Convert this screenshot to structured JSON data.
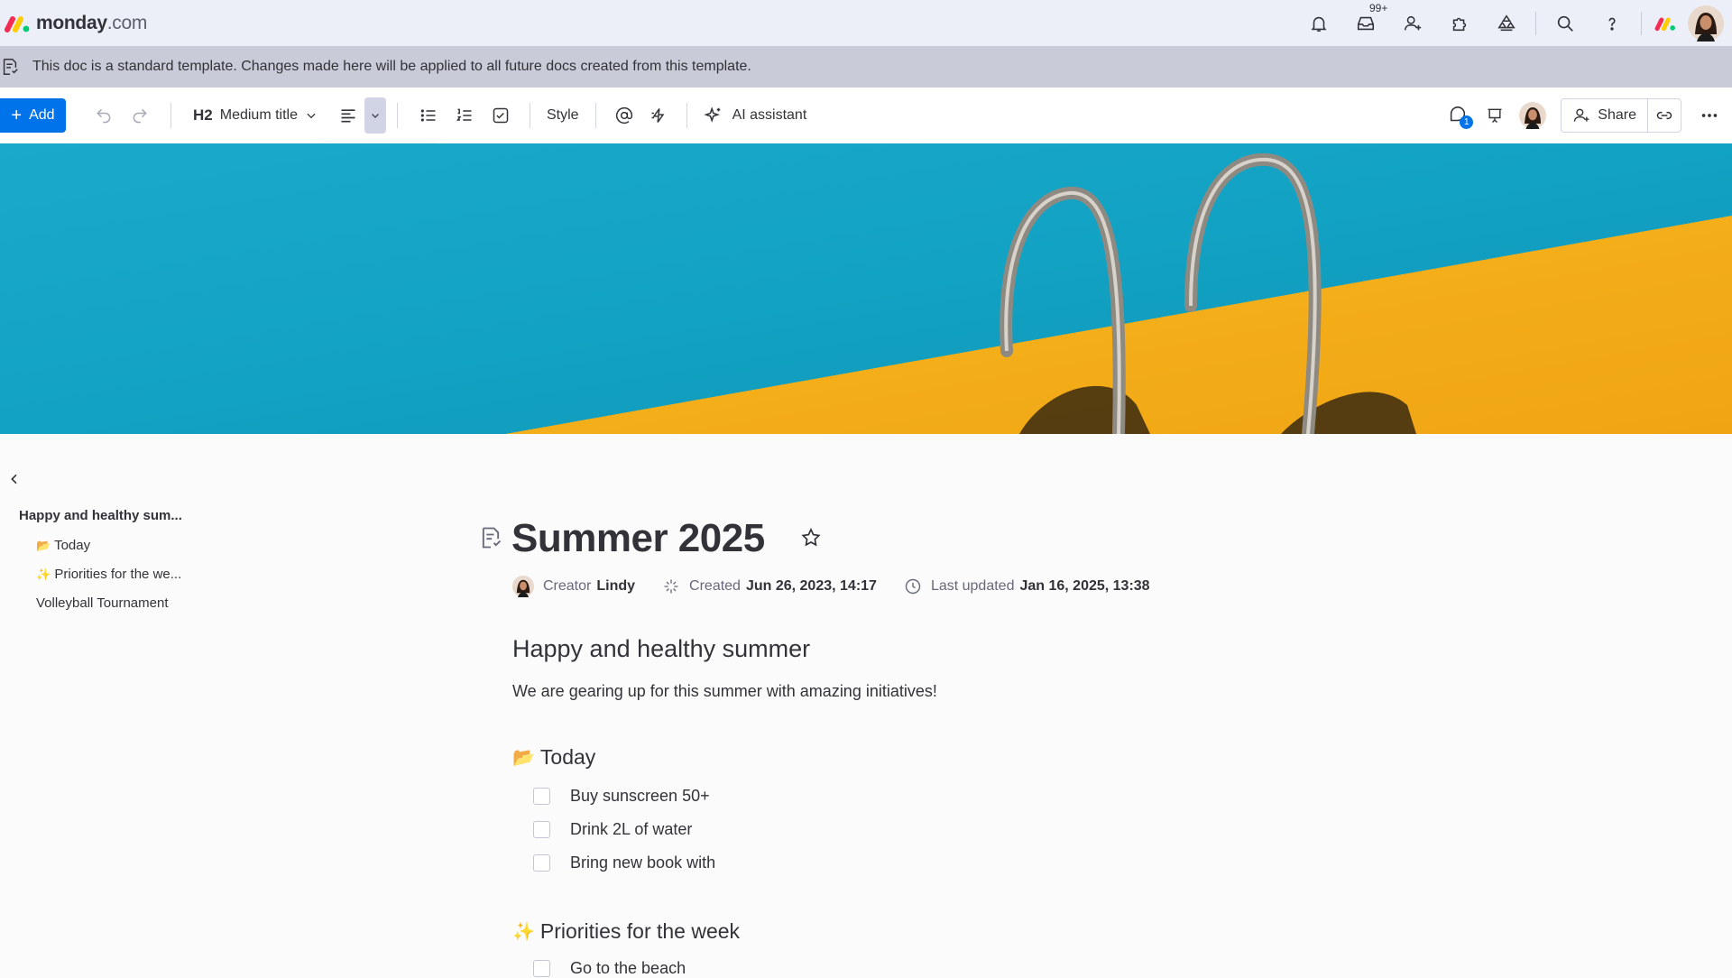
{
  "topbar": {
    "logo_text": "monday",
    "logo_suffix": ".com",
    "inbox_badge": "99+",
    "icons": [
      "bell-icon",
      "inbox-icon",
      "invite-members-icon",
      "apps-icon",
      "integrations-icon",
      "search-icon",
      "help-icon",
      "product-switcher-icon",
      "user-avatar"
    ]
  },
  "banner": {
    "text": "This doc is a standard template. Changes made here will be applied to all future docs created from this template."
  },
  "toolbar": {
    "add_label": "Add",
    "heading_badge": "H2",
    "heading_label": "Medium title",
    "style_label": "Style",
    "ai_label": "AI assistant",
    "share_label": "Share",
    "updates_count": "1"
  },
  "sidebar": {
    "title": "Happy and healthy sum...",
    "items": [
      {
        "emoji": "📂",
        "label": "Today"
      },
      {
        "emoji": "✨",
        "label": "Priorities for the we..."
      },
      {
        "emoji": "",
        "label": "Volleyball Tournament"
      }
    ]
  },
  "doc": {
    "title": "Summer 2025",
    "meta": {
      "creator_label": "Creator",
      "creator_name": "Lindy",
      "created_label": "Created",
      "created_value": "Jun 26, 2023, 14:17",
      "updated_label": "Last updated",
      "updated_value": "Jan 16, 2025, 13:38"
    },
    "heading": "Happy and healthy summer",
    "intro": "We are gearing up for this summer with amazing initiatives!",
    "sections": [
      {
        "emoji": "📂",
        "title": "Today",
        "items": [
          "Buy sunscreen 50+",
          "Drink 2L of water",
          "Bring new book with"
        ]
      },
      {
        "emoji": "✨",
        "title": "Priorities for the week",
        "items": [
          "Go to the beach"
        ]
      }
    ]
  },
  "colors": {
    "accent": "#0073ea",
    "topbar_bg": "#eceff8",
    "banner_bg": "#c9cbd8",
    "pool_water": "#16a3c4",
    "pool_deck": "#f5b01c"
  }
}
